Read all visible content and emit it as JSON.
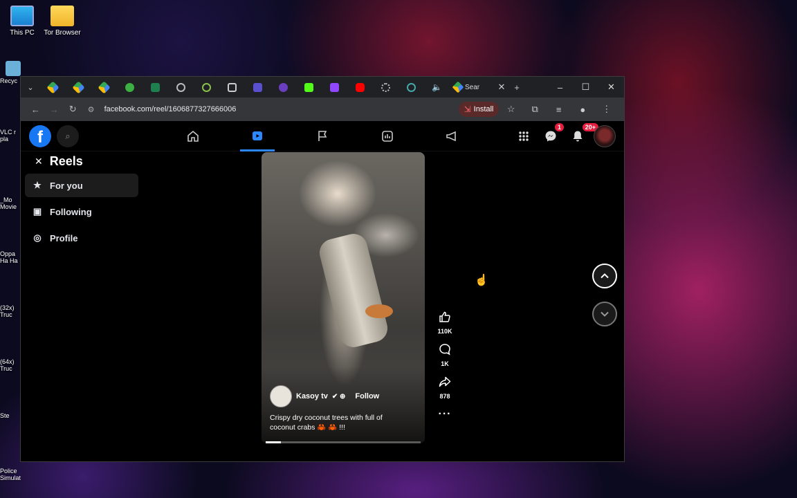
{
  "desktop": {
    "icons": [
      {
        "label": "This PC"
      },
      {
        "label": "Tor Browser"
      }
    ],
    "left_strip": [
      "Recyc",
      "VLC r\npla",
      "_Mo\nMovie",
      "Oppa\nHa Ha",
      "(32x)\nTruc",
      "(64x)\nTruc",
      "Ste",
      "Police\nSimulat..."
    ]
  },
  "browser": {
    "active_tab_label": "Sear",
    "url": "facebook.com/reel/1606877327666006",
    "install_label": "Install",
    "window_controls": [
      "–",
      "☐",
      "✕"
    ]
  },
  "facebook": {
    "messenger_badge": "1",
    "notifications_badge": "20+"
  },
  "reels_sidebar": {
    "title": "Reels",
    "items": [
      {
        "label": "For you",
        "icon": "star-icon"
      },
      {
        "label": "Following",
        "icon": "following-icon"
      },
      {
        "label": "Profile",
        "icon": "profile-icon"
      }
    ]
  },
  "reel": {
    "author": "Kasoy tv",
    "follow_label": "Follow",
    "caption": "Crispy dry coconut trees with full of coconut crabs 🦀 🦀 !!!",
    "likes": "110K",
    "comments": "1K",
    "shares": "878",
    "progress": 0.1
  }
}
